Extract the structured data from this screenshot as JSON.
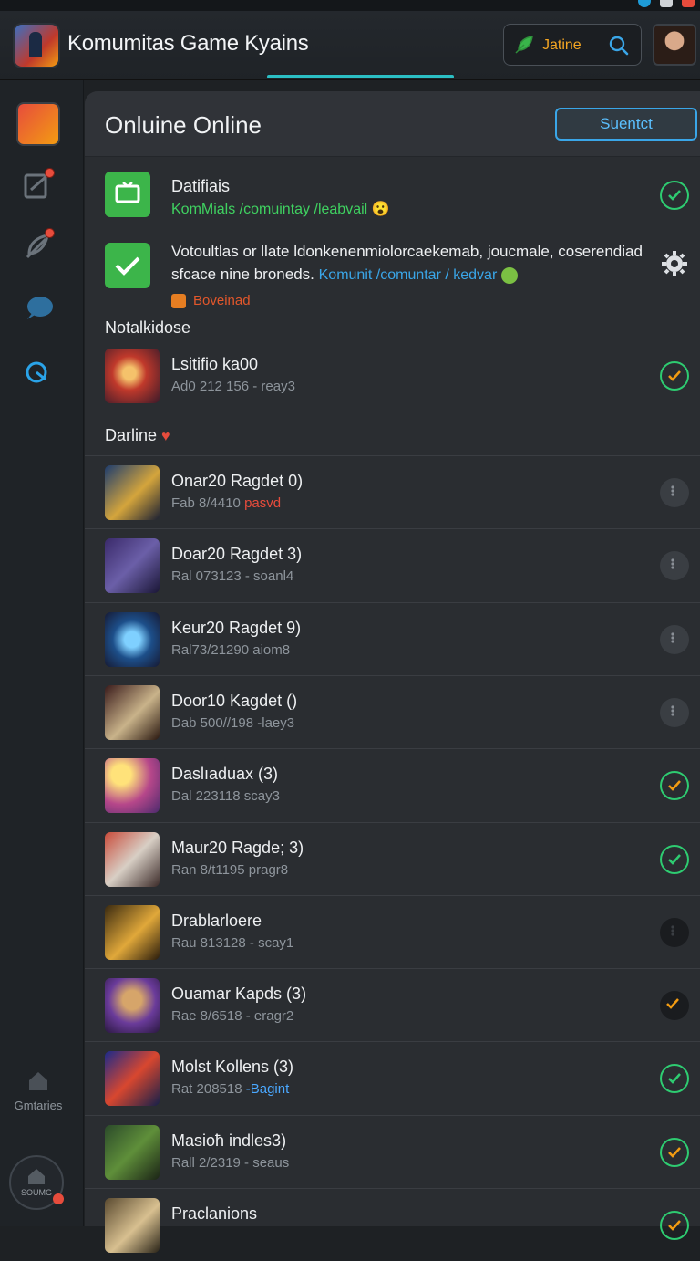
{
  "app": {
    "title": "Komumitas Game Kyains"
  },
  "search": {
    "placeholder": "Jatine"
  },
  "sidebar": {
    "bottom_label": "Gmtaries",
    "bottom_button_label": "SOUMG"
  },
  "panel": {
    "title": "Onluine Online",
    "button_label": "Suentct"
  },
  "notifications": [
    {
      "title": "Datifiais",
      "subtitle": "KomMials /comuintay /leabvail",
      "emoji": "😮",
      "status": "check-green"
    },
    {
      "title": "Votoultlas or llate ldonkenenmiolorcaekemab, joucmale, coserendiad",
      "title2": "sfcace nine broneds.",
      "link": "Komunit /comuntar / kedvar",
      "tag": "Boveinad",
      "status": "gear"
    }
  ],
  "sections": {
    "first": "Notalkidose",
    "second": "Darline"
  },
  "featured": {
    "title": "Lsitifio ka00",
    "subtitle": "Ad0 212 156 - reay3",
    "status": "check-orange"
  },
  "rows": [
    {
      "title": "Onar20 Ragdet 0)",
      "subtitle": "Fab 8/4410",
      "highlight": "pasvd",
      "highlight_color": "#e74c3c",
      "status": "more"
    },
    {
      "title": "Doar20 Ragdet 3)",
      "subtitle": "Ral 073123 - soanl4",
      "status": "more"
    },
    {
      "title": "Keur20 Ragdet 9)",
      "subtitle": "Ral73/21290 aiom8",
      "status": "more"
    },
    {
      "title": "Door10 Kagdet ()",
      "subtitle": "Dab 500//198 -laey3",
      "status": "more"
    },
    {
      "title": "Daslıaduax (3)",
      "subtitle": "Dal 223118 scay3",
      "status": "check-orange"
    },
    {
      "title": "Maur20 Ragde; 3)",
      "subtitle": "Ran 8/t1195 pragr8",
      "status": "check-green"
    },
    {
      "title": "Drablarloere",
      "subtitle": "Rau 813128 - scay1",
      "status": "solid"
    },
    {
      "title": "Ouamar Kapds (3)",
      "subtitle": "Rae 8/6518 - eragr2",
      "status": "solid-orange"
    },
    {
      "title": "Molst Kollens (3)",
      "subtitle": "Rat 208518",
      "highlight": "-Bagint",
      "highlight_color": "#4aa8ff",
      "status": "check-green"
    },
    {
      "title": "Masioħ indles3)",
      "subtitle": "Rall 2/2319 - seaus",
      "status": "check-orange"
    },
    {
      "title": "Praclanions",
      "subtitle": "",
      "status": "check-orange"
    }
  ],
  "colors": {
    "accent": "#2bbfc4",
    "green": "#2ecc71",
    "orange": "#f39c12",
    "link": "#4aa8ff"
  }
}
